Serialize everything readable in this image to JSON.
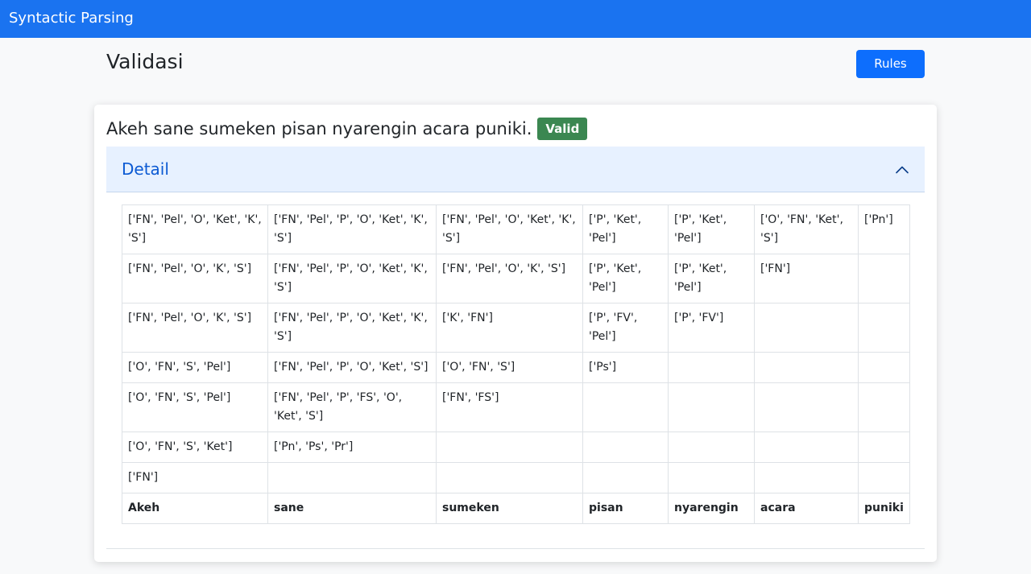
{
  "navbar": {
    "brand": "Syntactic Parsing"
  },
  "header": {
    "title": "Validasi",
    "rules_button": "Rules"
  },
  "result": {
    "sentence": "Akeh sane sumeken pisan nyarengin acara puniki.",
    "status": "Valid",
    "status_color": "#3b8751"
  },
  "detail": {
    "title": "Detail",
    "expanded": true,
    "icon": "chevron-up-icon"
  },
  "table": {
    "rows": [
      [
        "['FN', 'Pel', 'O', 'Ket', 'K', 'S']",
        "['FN', 'Pel', 'P', 'O', 'Ket', 'K', 'S']",
        "['FN', 'Pel', 'O', 'Ket', 'K', 'S']",
        "['P', 'Ket', 'Pel']",
        "['P', 'Ket', 'Pel']",
        "['O', 'FN', 'Ket', 'S']",
        "['Pn']"
      ],
      [
        "['FN', 'Pel', 'O', 'K', 'S']",
        "['FN', 'Pel', 'P', 'O', 'Ket', 'K', 'S']",
        "['FN', 'Pel', 'O', 'K', 'S']",
        "['P', 'Ket', 'Pel']",
        "['P', 'Ket', 'Pel']",
        "['FN']",
        ""
      ],
      [
        "['FN', 'Pel', 'O', 'K', 'S']",
        "['FN', 'Pel', 'P', 'O', 'Ket', 'K', 'S']",
        "['K', 'FN']",
        "['P', 'FV', 'Pel']",
        "['P', 'FV']",
        "",
        ""
      ],
      [
        "['O', 'FN', 'S', 'Pel']",
        "['FN', 'Pel', 'P', 'O', 'Ket', 'S']",
        "['O', 'FN', 'S']",
        "['Ps']",
        "",
        "",
        ""
      ],
      [
        "['O', 'FN', 'S', 'Pel']",
        "['FN', 'Pel', 'P', 'FS', 'O', 'Ket', 'S']",
        "['FN', 'FS']",
        "",
        "",
        "",
        ""
      ],
      [
        "['O', 'FN', 'S', 'Ket']",
        "['Pn', 'Ps', 'Pr']",
        "",
        "",
        "",
        "",
        ""
      ],
      [
        "['FN']",
        "",
        "",
        "",
        "",
        "",
        ""
      ]
    ],
    "words": [
      "Akeh",
      "sane",
      "sumeken",
      "pisan",
      "nyarengin",
      "acara",
      "puniki"
    ]
  },
  "colors": {
    "navbar": "#1a73f0",
    "primary_button": "#0d6efd",
    "accordion_header_bg": "#e7f1ff",
    "accordion_title": "#0c5ad3"
  }
}
